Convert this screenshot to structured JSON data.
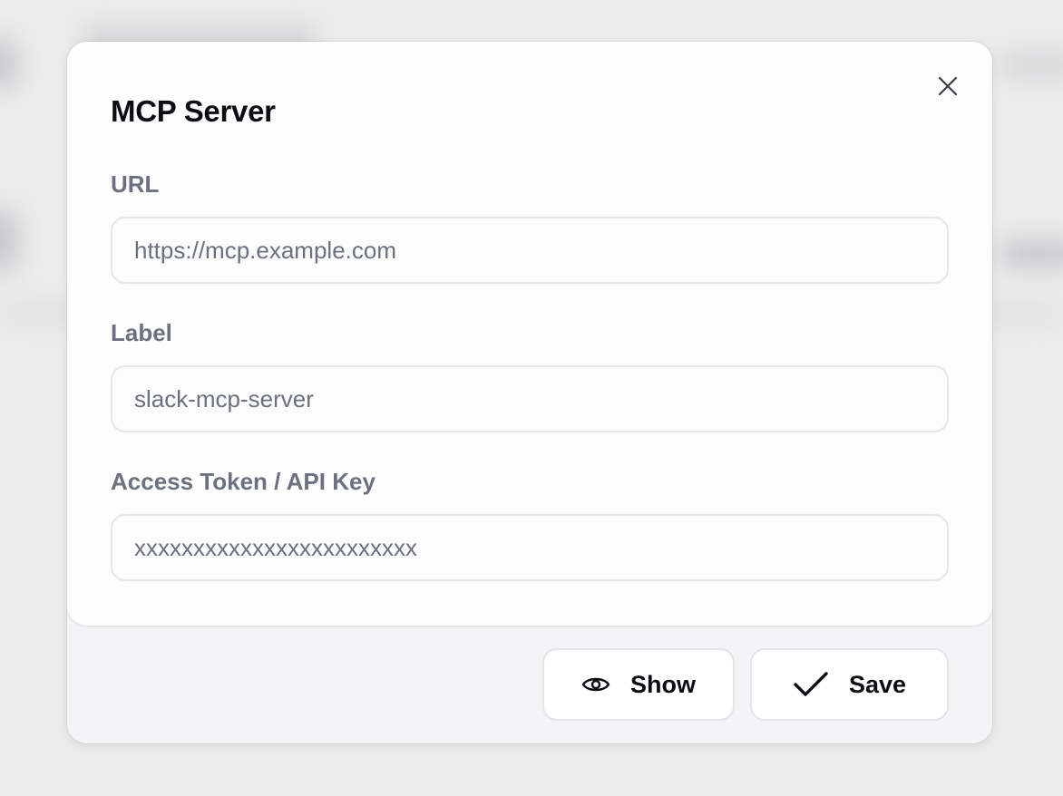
{
  "dialog": {
    "title": "MCP Server",
    "close_icon": "close-icon"
  },
  "fields": {
    "url": {
      "label": "URL",
      "placeholder": "https://mcp.example.com",
      "value": ""
    },
    "label": {
      "label": "Label",
      "placeholder": "slack-mcp-server",
      "value": ""
    },
    "token": {
      "label": "Access Token / API Key",
      "placeholder": "xxxxxxxxxxxxxxxxxxxxxxxx",
      "value": ""
    }
  },
  "footer": {
    "show_label": "Show",
    "show_icon": "eye-icon",
    "save_label": "Save",
    "save_icon": "check-icon"
  },
  "colors": {
    "title": "#0b0d12",
    "label": "#6b717e",
    "input_border": "#e5e6ea",
    "footer_bg": "#f4f4f6"
  }
}
